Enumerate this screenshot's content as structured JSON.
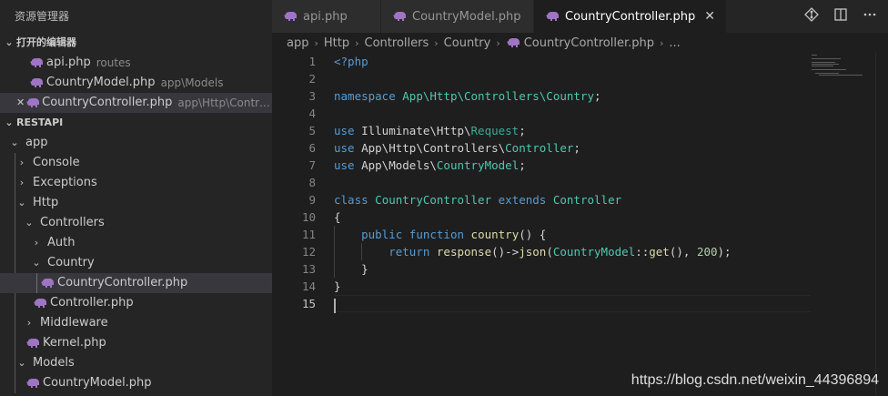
{
  "explorer": {
    "title": "资源管理器",
    "open_editors_label": "打开的编辑器",
    "open_editors": [
      {
        "name": "api.php",
        "desc": "routes",
        "close": ""
      },
      {
        "name": "CountryModel.php",
        "desc": "app\\Models",
        "close": ""
      },
      {
        "name": "CountryController.php",
        "desc": "app\\Http\\Controller...",
        "close": "✕"
      }
    ],
    "project_label": "RESTAPI",
    "tree": [
      {
        "label": "app",
        "chev": "⌄",
        "icon": false
      },
      {
        "label": "Console",
        "chev": "›",
        "icon": false
      },
      {
        "label": "Exceptions",
        "chev": "›",
        "icon": false
      },
      {
        "label": "Http",
        "chev": "⌄",
        "icon": false
      },
      {
        "label": "Controllers",
        "chev": "⌄",
        "icon": false
      },
      {
        "label": "Auth",
        "chev": "›",
        "icon": false
      },
      {
        "label": "Country",
        "chev": "⌄",
        "icon": false
      },
      {
        "label": "CountryController.php",
        "chev": "",
        "icon": true
      },
      {
        "label": "Controller.php",
        "chev": "",
        "icon": true
      },
      {
        "label": "Middleware",
        "chev": "›",
        "icon": false
      },
      {
        "label": "Kernel.php",
        "chev": "",
        "icon": true
      },
      {
        "label": "Models",
        "chev": "⌄",
        "icon": false
      },
      {
        "label": "CountryModel.php",
        "chev": "",
        "icon": true
      }
    ]
  },
  "tabs": [
    {
      "label": "api.php"
    },
    {
      "label": "CountryModel.php"
    },
    {
      "label": "CountryController.php",
      "close": "✕"
    }
  ],
  "tab_actions": [
    "git-compare-icon",
    "split-editor-icon",
    "more-icon"
  ],
  "breadcrumb": {
    "parts": [
      "app",
      "Http",
      "Controllers",
      "Country"
    ],
    "file": "CountryController.php",
    "trail": "..."
  },
  "editor": {
    "line_numbers": [
      "1",
      "2",
      "3",
      "4",
      "5",
      "6",
      "7",
      "8",
      "9",
      "10",
      "11",
      "12",
      "13",
      "14",
      "15"
    ],
    "code": {
      "l1": "<?php",
      "l3a": "namespace",
      "l3b": "App\\Http\\Controllers\\Country",
      "l3c": ";",
      "use": "use",
      "l5b": "Illuminate\\Http\\",
      "l5c": "Request",
      "l6b": "App\\Http\\Controllers\\",
      "l6c": "Controller",
      "l7b": "App\\Models\\",
      "l7c": "CountryModel",
      "semi": ";",
      "l9a": "class",
      "l9b": "CountryController",
      "l9c": "extends",
      "l9d": "Controller",
      "l10": "{",
      "l11a": "public",
      "l11b": "function",
      "l11c": "country",
      "l11d": "() {",
      "l12a": "return",
      "l12b": "response",
      "l12c": "()->",
      "l12d": "json",
      "l12e": "(",
      "l12f": "CountryModel",
      "l12g": "::",
      "l12h": "get",
      "l12i": "(), ",
      "l12j": "200",
      "l12k": ");",
      "l13": "}",
      "l14": "}"
    }
  },
  "watermark": "https://blog.csdn.net/weixin_44396894",
  "colors": {
    "php_icon": "#a074c4",
    "keyword": "#569cd6",
    "type": "#4ec9b0",
    "function": "#dcdcaa",
    "number": "#b5cea8"
  }
}
